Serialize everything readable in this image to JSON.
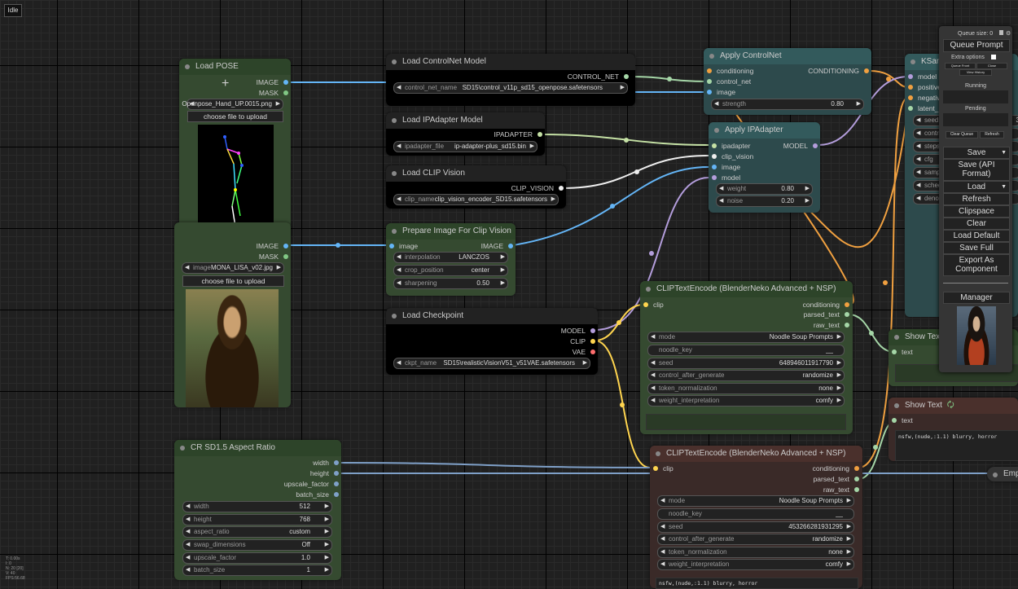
{
  "status": "Idle",
  "nodes": {
    "load_pose": {
      "title": "Load POSE",
      "out_image": "IMAGE",
      "out_mask": "MASK",
      "image_label": "image",
      "image_value": "Openpose_Hand_UP.0015.png",
      "upload": "choose file to upload"
    },
    "load_mona": {
      "out_image": "IMAGE",
      "out_mask": "MASK",
      "image_label": "image",
      "image_value": "MONA_LISA_v02.jpg",
      "upload": "choose file to upload"
    },
    "controlnet_loader": {
      "title": "Load ControlNet Model",
      "out": "CONTROL_NET",
      "label": "control_net_name",
      "value": "SD15\\control_v11p_sd15_openpose.safetensors"
    },
    "ipadapter_loader": {
      "title": "Load IPAdapter Model",
      "out": "IPADAPTER",
      "label": "ipadapter_file",
      "value": "ip-adapter-plus_sd15.bin"
    },
    "clipvision_loader": {
      "title": "Load CLIP Vision",
      "out": "CLIP_VISION",
      "label": "clip_name",
      "value": "clip_vision_encoder_SD15.safetensors"
    },
    "prep_image": {
      "title": "Prepare Image For Clip Vision",
      "in_image": "image",
      "out_image": "IMAGE",
      "interpolation_label": "interpolation",
      "interpolation_value": "LANCZOS",
      "crop_label": "crop_position",
      "crop_value": "center",
      "sharpening_label": "sharpening",
      "sharpening_value": "0.50"
    },
    "checkpoint": {
      "title": "Load Checkpoint",
      "out_model": "MODEL",
      "out_clip": "CLIP",
      "out_vae": "VAE",
      "label": "ckpt_name",
      "value": "SD15\\realisticVisionV51_v51VAE.safetensors"
    },
    "apply_controlnet": {
      "title": "Apply ControlNet",
      "in_cond": "conditioning",
      "in_cn": "control_net",
      "in_image": "image",
      "out": "CONDITIONING",
      "strength_label": "strength",
      "strength_value": "0.80"
    },
    "apply_ipadapter": {
      "title": "Apply IPAdapter",
      "in_ip": "ipadapter",
      "in_cv": "clip_vision",
      "in_image": "image",
      "in_model": "model",
      "out": "MODEL",
      "weight_label": "weight",
      "weight_value": "0.80",
      "noise_label": "noise",
      "noise_value": "0.20"
    },
    "ksampler": {
      "title": "KSam",
      "in_model": "model",
      "in_pos": "positive",
      "in_neg": "negative",
      "in_latent": "latent_in",
      "w_seed": "seed",
      "w_seed_val": "3",
      "w_control": "contr",
      "w_steps": "steps",
      "w_cfg": "cfg",
      "w_sampler": "samp",
      "w_sched": "sched",
      "w_denoise": "denoi"
    },
    "clip_pos": {
      "title": "CLIPTextEncode (BlenderNeko Advanced + NSP)",
      "in_clip": "clip",
      "out_cond": "conditioning",
      "out_parsed": "parsed_text",
      "out_raw": "raw_text",
      "mode_label": "mode",
      "mode_value": "Noodle Soup Prompts",
      "noodle_key": "noodle_key",
      "noodle_val": "__",
      "seed_label": "seed",
      "seed_value": "648946011917790",
      "cag_label": "control_after_generate",
      "cag_value": "randomize",
      "tn_label": "token_normalization",
      "tn_value": "none",
      "wi_label": "weight_interpretation",
      "wi_value": "comfy"
    },
    "clip_neg": {
      "title": "CLIPTextEncode (BlenderNeko Advanced + NSP)",
      "in_clip": "clip",
      "out_cond": "conditioning",
      "out_parsed": "parsed_text",
      "out_raw": "raw_text",
      "mode_label": "mode",
      "mode_value": "Noodle Soup Prompts",
      "noodle_key": "noodle_key",
      "noodle_val": "__",
      "seed_label": "seed",
      "seed_value": "453266281931295",
      "cag_label": "control_after_generate",
      "cag_value": "randomize",
      "tn_label": "token_normalization",
      "tn_value": "none",
      "wi_label": "weight_interpretation",
      "wi_value": "comfy",
      "text": "nsfw,(nude,:1.1) blurry, horror"
    },
    "show_text_1": {
      "title": "Show Text",
      "in_text": "text"
    },
    "show_text_2": {
      "title": "Show Text",
      "in_text": "text",
      "text": "nsfw,(nude,:1.1) blurry, horror"
    },
    "aspect": {
      "title": "CR SD1.5 Aspect Ratio",
      "out_width": "width",
      "out_height": "height",
      "out_upscale": "upscale_factor",
      "out_batch": "batch_size",
      "width_label": "width",
      "width_value": "512",
      "height_label": "height",
      "height_value": "768",
      "ar_label": "aspect_ratio",
      "ar_value": "custom",
      "swap_label": "swap_dimensions",
      "swap_value": "Off",
      "up_label": "upscale_factor",
      "up_value": "1.0",
      "bs_label": "batch_size",
      "bs_value": "1"
    },
    "empty": {
      "title": "Emp"
    }
  },
  "menu": {
    "queue_size": "Queue size: 0",
    "queue_prompt": "Queue Prompt",
    "extra_options": "Extra options",
    "queue_front": "Queue Front",
    "close": "Close",
    "view_history": "View History",
    "running": "Running",
    "pending": "Pending",
    "clear_queue": "Clear Queue",
    "refresh_small": "Refresh",
    "save": "Save",
    "save_api": "Save (API Format)",
    "load": "Load",
    "refresh": "Refresh",
    "clipspace": "Clipspace",
    "clear": "Clear",
    "load_default": "Load Default",
    "save_full": "Save Full",
    "export_component": "Export As Component",
    "manager": "Manager"
  },
  "stats": [
    "T: 0.00s",
    "I: 0",
    "N: 20 [20]",
    "V: 40",
    "FPS:56.68"
  ]
}
